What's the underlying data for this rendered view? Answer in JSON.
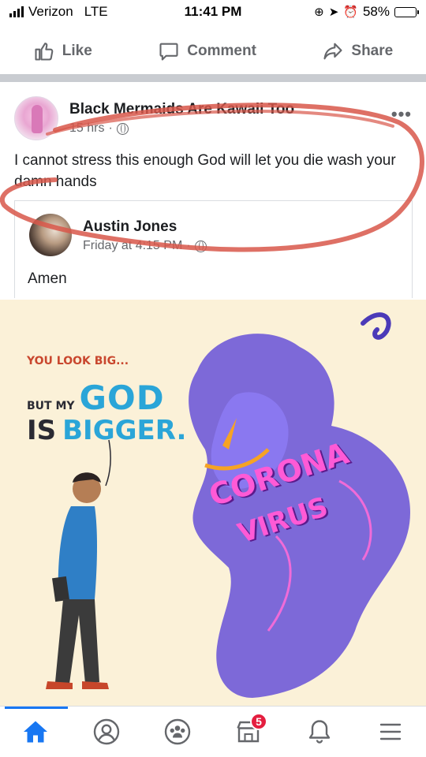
{
  "status_bar": {
    "carrier": "Verizon",
    "network": "LTE",
    "time": "11:41 PM",
    "battery": "58%",
    "battery_level": 0.58
  },
  "actions": {
    "like": "Like",
    "comment": "Comment",
    "share": "Share"
  },
  "post": {
    "author": "Black Mermaids Are Kawaii Too",
    "time": "15 hrs",
    "text": "I cannot stress this enough God will let you die wash your damn hands"
  },
  "shared_post": {
    "author": "Austin Jones",
    "time": "Friday at 4:15 PM",
    "text": "Amen"
  },
  "illustration": {
    "line1": "YOU LOOK BIG...",
    "line2_small": "BUT MY",
    "line2_big": "GOD",
    "line3_is": "IS",
    "line3_big": "BIGGER.",
    "monster_word1": "CORONA",
    "monster_word2": "VIRUS"
  },
  "tab_bar": {
    "notifications_badge": "5",
    "active_tab": "home",
    "accent_color": "#1877f2"
  }
}
